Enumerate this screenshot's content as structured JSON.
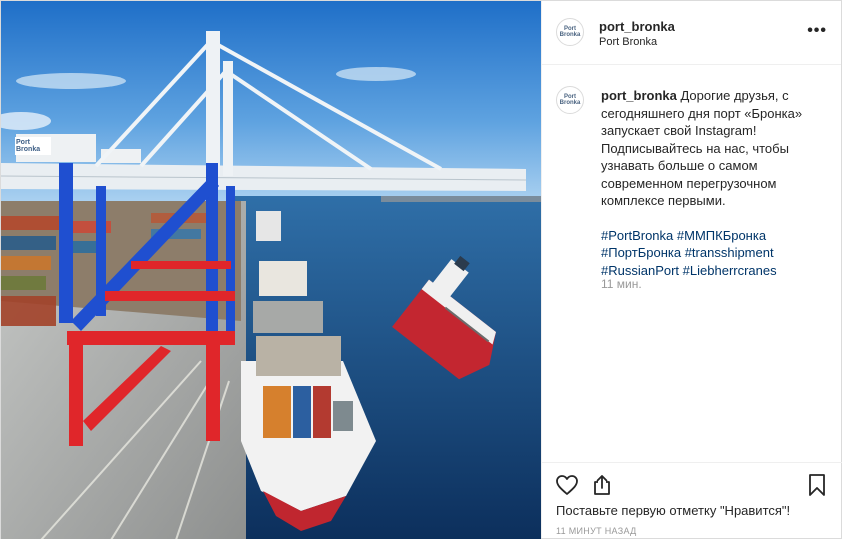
{
  "header": {
    "username": "port_bronka",
    "location": "Port Bronka",
    "more_label": "•••",
    "avatar_text": "Port\nBronka"
  },
  "photo": {
    "sign_text": "Port\nBronka"
  },
  "caption": {
    "username": "port_bronka",
    "text": "Дорогие друзья, с сегодняшнего дня порт «Бронка» запускает свой Instagram! Подписывайтесь на нас, чтобы узнавать больше о самом современном перегрузочном комплексе первыми.",
    "hashtags": [
      "#PortBronka",
      "#ММПКБронка",
      "#ПортБронка",
      "#transshipment",
      "#RussianPort",
      "#Liebherrcranes"
    ],
    "time": "11 мин."
  },
  "actions": {
    "likes_text": "Поставьте первую отметку \"Нравится\"!",
    "timestamp": "11 МИНУТ НАЗАД"
  }
}
